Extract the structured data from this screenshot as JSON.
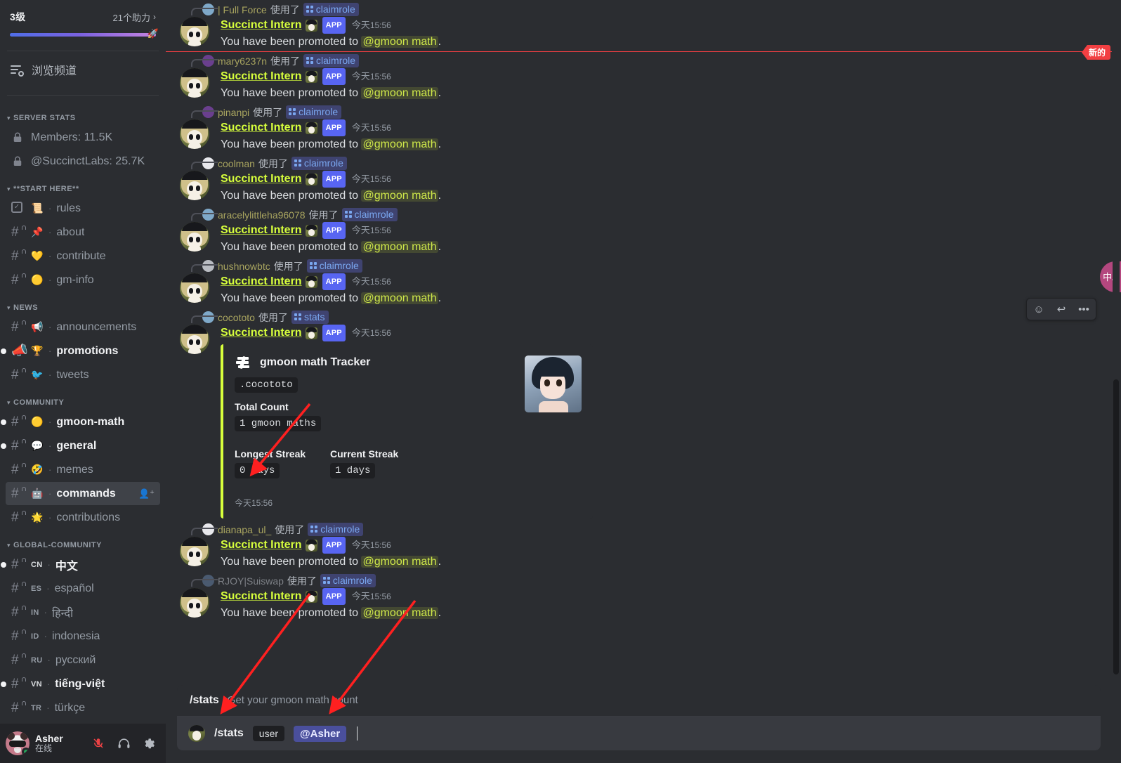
{
  "sidebar": {
    "boost": {
      "level": "3级",
      "count": "21个助力",
      "chevron": "›",
      "rocket": "🚀"
    },
    "browse": {
      "label": "浏览频道",
      "icon": "browse-channels-icon"
    },
    "categories": [
      {
        "name": "SERVER STATS",
        "channels": [
          {
            "label": "Members: 11.5K",
            "icon": "lock-icon",
            "type": "stat"
          },
          {
            "label": "@SuccinctLabs: 25.7K",
            "icon": "lock-icon",
            "type": "stat"
          }
        ]
      },
      {
        "name": "**START HERE**",
        "channels": [
          {
            "emoji": "📜",
            "sep": "·",
            "label": "rules",
            "type": "rules",
            "unread": false
          },
          {
            "emoji": "📌",
            "sep": "·",
            "label": "about",
            "type": "text",
            "unread": false
          },
          {
            "emoji": "💛",
            "sep": "·",
            "label": "contribute",
            "type": "text",
            "unread": false
          },
          {
            "emoji": "🟡",
            "sep": "·",
            "label": "gm-info",
            "type": "text",
            "unread": false
          }
        ]
      },
      {
        "name": "NEWS",
        "channels": [
          {
            "emoji": "📢",
            "sep": "·",
            "label": "announcements",
            "type": "text",
            "unread": false
          },
          {
            "emoji": "🏆",
            "sep": "·",
            "label": "promotions",
            "type": "announcement",
            "unread": true
          },
          {
            "emoji": "🐦",
            "sep": "·",
            "label": "tweets",
            "type": "text",
            "unread": false
          }
        ]
      },
      {
        "name": "COMMUNITY",
        "channels": [
          {
            "emoji": "🟡",
            "sep": "·",
            "label": "gmoon-math",
            "type": "text",
            "unread": true
          },
          {
            "emoji": "💬",
            "sep": "·",
            "label": "general",
            "type": "text",
            "unread": true
          },
          {
            "emoji": "🤣",
            "sep": "·",
            "label": "memes",
            "type": "text",
            "unread": false
          },
          {
            "emoji": "🤖",
            "sep": "·",
            "label": "commands",
            "type": "text",
            "active": true,
            "invite_icon": "add-member-icon"
          },
          {
            "emoji": "🌟",
            "sep": "·",
            "label": "contributions",
            "type": "text",
            "unread": false
          }
        ]
      },
      {
        "name": "GLOBAL-COMMUNITY",
        "channels": [
          {
            "tag": "CN",
            "sep": "·",
            "label": "中文",
            "type": "text",
            "unread": true
          },
          {
            "tag": "ES",
            "sep": "·",
            "label": "español",
            "type": "text",
            "unread": false
          },
          {
            "tag": "IN",
            "sep": "·",
            "label": "हिन्दी",
            "type": "text",
            "unread": false
          },
          {
            "tag": "ID",
            "sep": "·",
            "label": "indonesia",
            "type": "text",
            "unread": false
          },
          {
            "tag": "RU",
            "sep": "·",
            "label": "русский",
            "type": "text",
            "unread": false
          },
          {
            "tag": "VN",
            "sep": "·",
            "label": "tiếng-việt",
            "type": "text",
            "unread": true
          },
          {
            "tag": "TR",
            "sep": "·",
            "label": "türkçe",
            "type": "text",
            "unread": false
          }
        ]
      }
    ],
    "user": {
      "name": "Asher",
      "status": "在线",
      "avatar": "panda-avatar",
      "buttons": [
        {
          "icon": "microphone-muted-icon"
        },
        {
          "icon": "headphones-icon"
        },
        {
          "icon": "settings-gear-icon"
        }
      ]
    }
  },
  "new_divider": {
    "label": "新的"
  },
  "bot": {
    "name": "Succinct Intern",
    "badge": "APP",
    "timestamp_cn": "今天",
    "timestamp_time": "15:56",
    "promote_text_before": "You have been promoted to ",
    "promote_role": "@gmoon math",
    "promote_text_after": "."
  },
  "messages": [
    {
      "user": "| Full Force",
      "action": "使用了",
      "command": "claimrole",
      "dim": false
    },
    {
      "user": "mary6237n",
      "action": "使用了",
      "command": "claimrole",
      "dim": false
    },
    {
      "user": "pinanpi",
      "action": "使用了",
      "command": "claimrole",
      "dim": false
    },
    {
      "user": "coolman",
      "action": "使用了",
      "command": "claimrole",
      "dim": false
    },
    {
      "user": "aracelylittleha96078",
      "action": "使用了",
      "command": "claimrole",
      "dim": false
    },
    {
      "user": "hushnowbtc",
      "action": "使用了",
      "command": "claimrole",
      "dim": false
    }
  ],
  "stats_message": {
    "user": "cocototo",
    "action": "使用了",
    "command": "stats",
    "embed": {
      "author_icon": "succinct-s-logo",
      "title": "gmoon math Tracker",
      "username_code": ".cocototo",
      "total_count_label": "Total Count",
      "total_count_value": "1 gmoon maths",
      "longest_streak_label": "Longest Streak",
      "longest_streak_value": "0 days",
      "current_streak_label": "Current Streak",
      "current_streak_value": "1 days",
      "timestamp_cn": "今天",
      "timestamp_time": "15:56",
      "accent_color": "#d7ff3c",
      "thumbnail": "anime-character-thumbnail"
    },
    "hover_tools": [
      {
        "icon": "add-reaction-emoji-icon"
      },
      {
        "icon": "reply-arrow-icon"
      },
      {
        "icon": "more-options-icon"
      }
    ]
  },
  "messages_after": [
    {
      "user": "dianapa_ul_",
      "action": "使用了",
      "command": "claimrole",
      "dim": false
    },
    {
      "user": "RJOY|Suiswap",
      "action": "使用了",
      "command": "claimrole",
      "dim": true
    }
  ],
  "command_box": {
    "suggestion_name": "/stats",
    "suggestion_desc": "Get your gmoon math count",
    "input_command": "/stats",
    "param_key": "user",
    "param_value": "@Asher"
  },
  "translate_widget": {
    "icon": "translate-icon",
    "glyph": "中A",
    "color": "#b4477f"
  },
  "colors": {
    "background": "#2b2d31",
    "sidebar": "#2b2d31",
    "user_area": "#232428",
    "accent_lime": "#d7ff3c",
    "blurple": "#5865f2",
    "new_red": "#f23f42",
    "online_green": "#23a55a"
  }
}
